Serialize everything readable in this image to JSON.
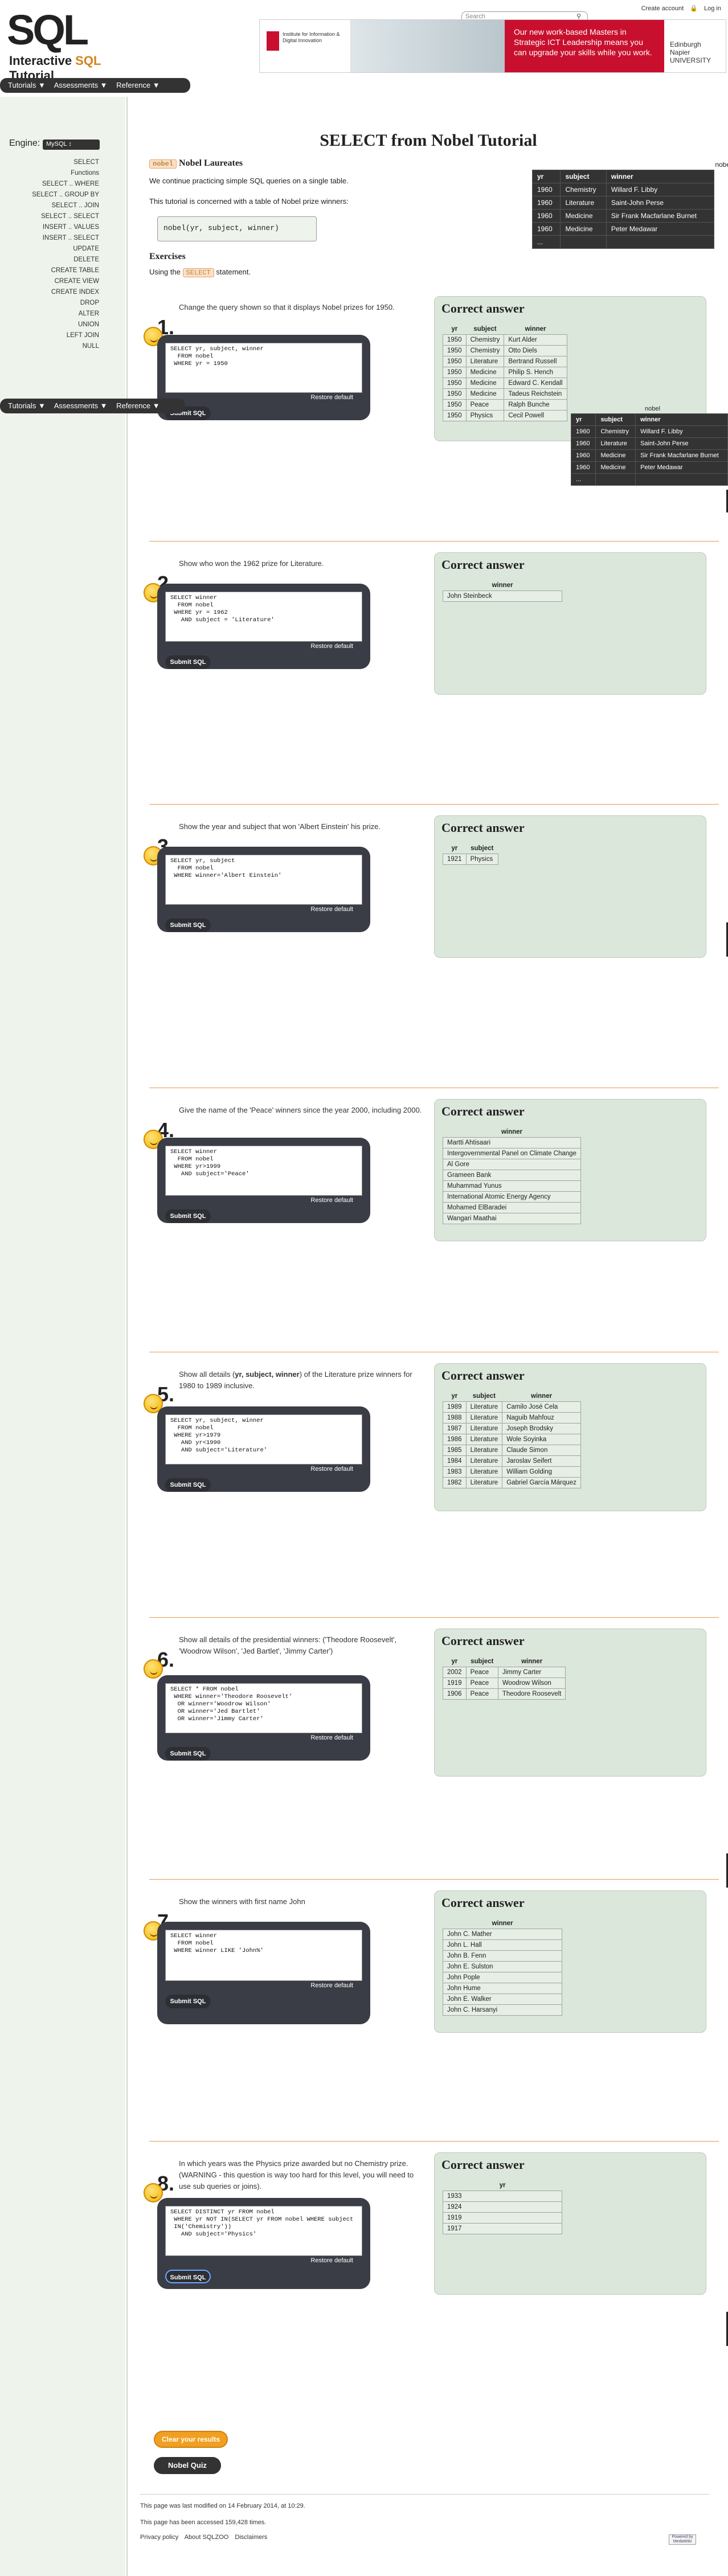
{
  "header": {
    "logo_text": "SQL",
    "logo_sub_prefix": "Interactive ",
    "logo_sub_accent": "SQL",
    "logo_sub_suffix": " Tutorial",
    "search_placeholder": "Search",
    "create_account": "Create account",
    "log_in": "Log in",
    "banner_institute": "Institute for Information & Digital Innovation",
    "banner_ad": "Our new work-based Masters in Strategic ICT Leadership means you can upgrade your skills while you work.",
    "banner_uni": "Edinburgh Napier UNIVERSITY",
    "menu": [
      "Tutorials ▼",
      "Assessments ▼",
      "Reference ▼"
    ]
  },
  "sidebar": {
    "engine_label": "Engine:",
    "engine_value": "MySQL",
    "links": [
      "SELECT",
      "Functions",
      "SELECT .. WHERE",
      "SELECT .. GROUP BY",
      "SELECT .. JOIN",
      "SELECT .. SELECT",
      "INSERT .. VALUES",
      "INSERT .. SELECT",
      "UPDATE",
      "DELETE",
      "CREATE TABLE",
      "CREATE VIEW",
      "CREATE INDEX",
      "DROP",
      "ALTER",
      "UNION",
      "LEFT JOIN",
      "NULL"
    ]
  },
  "main": {
    "title": "SELECT from Nobel Tutorial",
    "nobel_badge": "nobel",
    "nobel_heading": "Nobel Laureates",
    "intro1": "We continue practicing simple SQL queries on a single table.",
    "intro2": "This tutorial is concerned with a table of Nobel prize winners:",
    "schema": "nobel(yr, subject, winner)",
    "exercises_heading": "Exercises",
    "using_prefix": "Using the",
    "using_badge": "SELECT",
    "using_suffix": "statement.",
    "nobel_caption": "nobel",
    "nobel_table": {
      "headers": [
        "yr",
        "subject",
        "winner"
      ],
      "rows": [
        [
          "1960",
          "Chemistry",
          "Willard F. Libby"
        ],
        [
          "1960",
          "Literature",
          "Saint-John Perse"
        ],
        [
          "1960",
          "Medicine",
          "Sir Frank Macfarlane Burnet"
        ],
        [
          "1960",
          "Medicine",
          "Peter Medawar"
        ],
        [
          "...",
          "",
          ""
        ]
      ]
    },
    "nobel_caption2": "nobel",
    "nobel_table2": {
      "headers": [
        "yr",
        "subject",
        "winner"
      ],
      "rows": [
        [
          "1960",
          "Chemistry",
          "Willard F. Libby"
        ],
        [
          "1960",
          "Literature",
          "Saint-John Perse"
        ],
        [
          "1960",
          "Medicine",
          "Sir Frank Macfarlane Burnet"
        ],
        [
          "1960",
          "Medicine",
          "Peter Medawar"
        ],
        [
          "...",
          "",
          ""
        ]
      ]
    }
  },
  "common": {
    "answer_heading": "Correct answer",
    "restore": "Restore default",
    "submit": "Submit SQL"
  },
  "q1": {
    "num": "1.",
    "text": "Change the query shown so that it displays Nobel prizes for 1950.",
    "code": "SELECT yr, subject, winner\n  FROM nobel\n WHERE yr = 1950",
    "headers": [
      "yr",
      "subject",
      "winner"
    ],
    "rows": [
      [
        "1950",
        "Chemistry",
        "Kurt Alder"
      ],
      [
        "1950",
        "Chemistry",
        "Otto Diels"
      ],
      [
        "1950",
        "Literature",
        "Bertrand Russell"
      ],
      [
        "1950",
        "Medicine",
        "Philip S. Hench"
      ],
      [
        "1950",
        "Medicine",
        "Edward C. Kendall"
      ],
      [
        "1950",
        "Medicine",
        "Tadeus Reichstein"
      ],
      [
        "1950",
        "Peace",
        "Ralph Bunche"
      ],
      [
        "1950",
        "Physics",
        "Cecil Powell"
      ]
    ]
  },
  "q2": {
    "num": "2.",
    "text": "Show who won the 1962 prize for Literature.",
    "code": "SELECT winner\n  FROM nobel\n WHERE yr = 1962\n   AND subject = 'Literature'",
    "headers": [
      "winner"
    ],
    "rows": [
      [
        "John Steinbeck"
      ]
    ]
  },
  "q3": {
    "num": "3.",
    "text": "Show the year and subject that won 'Albert Einstein' his prize.",
    "code": "SELECT yr, subject\n  FROM nobel\n WHERE winner='Albert Einstein'",
    "headers": [
      "yr",
      "subject"
    ],
    "rows": [
      [
        "1921",
        "Physics"
      ]
    ]
  },
  "q4": {
    "num": "4.",
    "text": "Give the name of the 'Peace' winners since the year 2000, including 2000.",
    "code": "SELECT winner\n  FROM nobel\n WHERE yr>1999\n   AND subject='Peace'",
    "headers": [
      "winner"
    ],
    "rows": [
      [
        "Martti Ahtisaari"
      ],
      [
        "Intergovernmental Panel on Climate Change"
      ],
      [
        "Al Gore"
      ],
      [
        "Grameen Bank"
      ],
      [
        "Muhammad Yunus"
      ],
      [
        "International Atomic Energy Agency"
      ],
      [
        "Mohamed ElBaradei"
      ],
      [
        "Wangari Maathai"
      ]
    ]
  },
  "q5": {
    "num": "5.",
    "text_prefix": "Show all details (",
    "text_bold": "yr, subject, winner",
    "text_suffix": ") of the Literature prize winners for 1980 to 1989 inclusive.",
    "code": "SELECT yr, subject, winner\n  FROM nobel\n WHERE yr>1979\n   AND yr<1990\n   AND subject='Literature'",
    "headers": [
      "yr",
      "subject",
      "winner"
    ],
    "rows": [
      [
        "1989",
        "Literature",
        "Camilo José Cela"
      ],
      [
        "1988",
        "Literature",
        "Naguib Mahfouz"
      ],
      [
        "1987",
        "Literature",
        "Joseph Brodsky"
      ],
      [
        "1986",
        "Literature",
        "Wole Soyinka"
      ],
      [
        "1985",
        "Literature",
        "Claude Simon"
      ],
      [
        "1984",
        "Literature",
        "Jaroslav Seifert"
      ],
      [
        "1983",
        "Literature",
        "William Golding"
      ],
      [
        "1982",
        "Literature",
        "Gabriel García Márquez"
      ]
    ]
  },
  "q6": {
    "num": "6.",
    "text": "Show all details of the presidential winners: ('Theodore Roosevelt', 'Woodrow Wilson', 'Jed Bartlet', 'Jimmy Carter')",
    "code": "SELECT * FROM nobel\n WHERE winner='Theodore Roosevelt'\n  OR winner='Woodrow Wilson'\n  OR winner='Jed Bartlet'\n  OR winner='Jimmy Carter'",
    "headers": [
      "yr",
      "subject",
      "winner"
    ],
    "rows": [
      [
        "2002",
        "Peace",
        "Jimmy Carter"
      ],
      [
        "1919",
        "Peace",
        "Woodrow Wilson"
      ],
      [
        "1906",
        "Peace",
        "Theodore Roosevelt"
      ]
    ]
  },
  "q7": {
    "num": "7.",
    "text": "Show the winners with first name John",
    "code": "SELECT winner\n  FROM nobel\n WHERE winner LIKE 'John%'",
    "headers": [
      "winner"
    ],
    "rows": [
      [
        "John C. Mather"
      ],
      [
        "John L. Hall"
      ],
      [
        "John B. Fenn"
      ],
      [
        "John E. Sulston"
      ],
      [
        "John Pople"
      ],
      [
        "John Hume"
      ],
      [
        "John E. Walker"
      ],
      [
        "John C. Harsanyi"
      ]
    ]
  },
  "q8": {
    "num": "8.",
    "text": "In which years was the Physics prize awarded but no Chemistry prize. (WARNING - this question is way too hard for this level, you will need to use sub queries or joins).",
    "code": "SELECT DISTINCT yr FROM nobel\n WHERE yr NOT IN(SELECT yr FROM nobel WHERE subject\n IN('Chemistry'))\n   AND subject='Physics'",
    "headers": [
      "yr"
    ],
    "rows": [
      [
        "1933"
      ],
      [
        "1924"
      ],
      [
        "1919"
      ],
      [
        "1917"
      ]
    ]
  },
  "footer": {
    "clear": "Clear your results",
    "quiz": "Nobel Quiz",
    "modified": "This page was last modified on 14 February 2014, at 10:29.",
    "accessed": "This page has been accessed 159,428 times.",
    "links": [
      "Privacy policy",
      "About SQLZOO",
      "Disclaimers"
    ],
    "powered": "Powered by MediaWiki"
  }
}
